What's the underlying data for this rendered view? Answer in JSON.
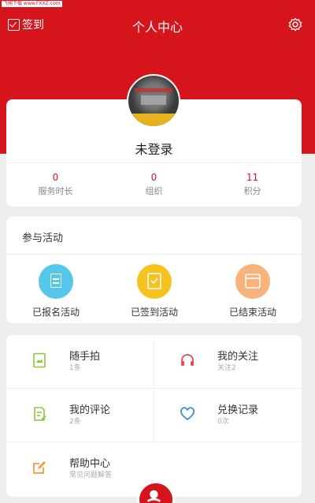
{
  "watermark": "飞翔下载 www.FXXZ.com",
  "header": {
    "signin_label": "签到",
    "title": "个人中心"
  },
  "profile": {
    "username": "未登录",
    "stats": [
      {
        "value": "0",
        "label": "服务时长"
      },
      {
        "value": "0",
        "label": "组织"
      },
      {
        "value": "11",
        "label": "积分"
      }
    ]
  },
  "activities": {
    "title": "参与活动",
    "items": [
      {
        "label": "已报名活动",
        "color": "#55c8ea"
      },
      {
        "label": "已签到活动",
        "color": "#f6c21f"
      },
      {
        "label": "已结束活动",
        "color": "#f8b27a"
      }
    ]
  },
  "menu": {
    "items": [
      {
        "title": "随手拍",
        "sub": "1条",
        "icon": "photo-icon",
        "color": "#8cc63e"
      },
      {
        "title": "我的关注",
        "sub": "关注2",
        "icon": "headphones-icon",
        "color": "#e94b55"
      },
      {
        "title": "我的评论",
        "sub": "2条",
        "icon": "edit-doc-icon",
        "color": "#8cc63e"
      },
      {
        "title": "兑换记录",
        "sub": "0次",
        "icon": "heart-icon",
        "color": "#3f8fd8"
      },
      {
        "title": "帮助中心",
        "sub": "常见问题解答",
        "icon": "edit-icon",
        "color": "#f39b3b"
      }
    ]
  },
  "colors": {
    "brand": "#d6141b"
  }
}
